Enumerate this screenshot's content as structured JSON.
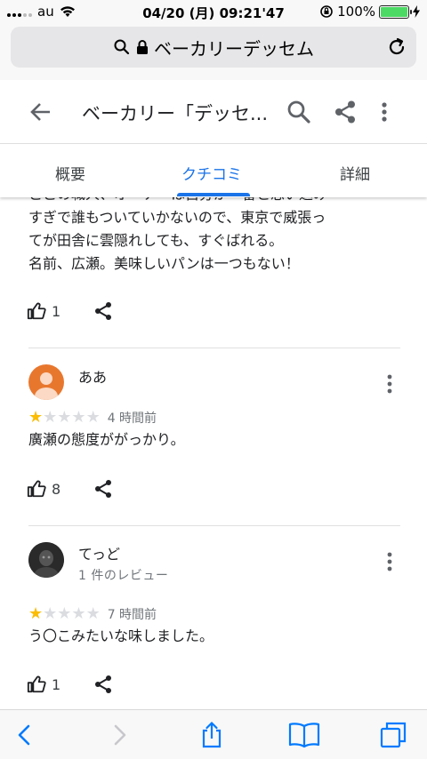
{
  "status": {
    "carrier": "au",
    "time": "04/20 (月) 09:21'47",
    "battery": "100%"
  },
  "browser": {
    "url_title": "ベーカリーデッセム"
  },
  "header": {
    "title": "ベーカリー「デッセ..."
  },
  "tabs": [
    {
      "label": "概要"
    },
    {
      "label": "クチコミ"
    },
    {
      "label": "詳細"
    }
  ],
  "active_tab": "クチコミ",
  "reviews": [
    {
      "partial_line": "ここの職人、オーナーは自分が一番と思い込み",
      "text_lines": [
        "すぎで誰もついていかないので、東京で威張っ",
        "てが田舎に雲隠れしても、すぐばれる。",
        "名前、広瀬。美味しいパンは一つもない！"
      ],
      "likes": "1"
    },
    {
      "name": "ああ",
      "rating": 1,
      "time_ago": "4 時間前",
      "text": "廣瀬の態度ががっかり。",
      "likes": "8"
    },
    {
      "name": "てっど",
      "review_count": "1 件のレビュー",
      "rating": 1,
      "time_ago": "7 時間前",
      "text": "う〇こみたいな味しました。",
      "likes": "1"
    }
  ],
  "colors": {
    "accent": "#1a73e8",
    "star": "#fbbc04",
    "star_empty": "#dadce0",
    "ios_blue": "#007aff"
  }
}
